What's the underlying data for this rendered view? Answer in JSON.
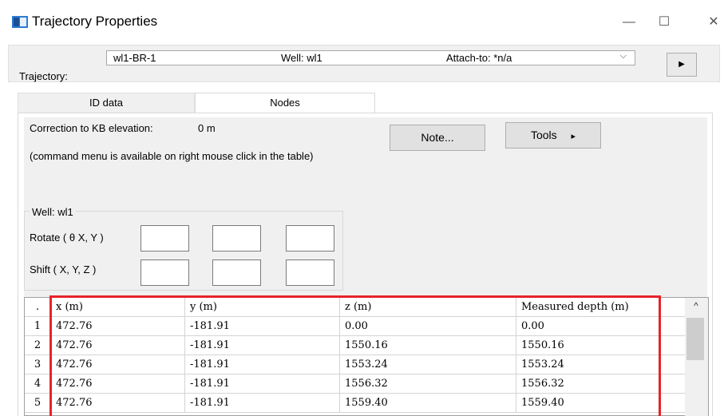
{
  "window": {
    "title": "Trajectory Properties",
    "minimize": "—",
    "maximize": "☐",
    "close": "✕"
  },
  "top": {
    "trajectory_label": "Trajectory:",
    "combo": {
      "name": "wl1-BR-1",
      "well": "Well: wl1",
      "attach": "Attach-to: *n/a",
      "arrow": "⌵"
    },
    "play_icon": "▶"
  },
  "tabs": [
    {
      "label": "ID data",
      "active": false
    },
    {
      "label": "Nodes",
      "active": true
    }
  ],
  "nodes": {
    "correction_label": "Correction to KB elevation:",
    "correction_value": "0  m",
    "hint": "(command menu is available on right mouse click in the table)",
    "note_button": "Note...",
    "tools_button": "Tools",
    "tools_arrow": "▸",
    "group_title": "Well: wl1",
    "rotate_label": "Rotate (  θ  X, Y )",
    "shift_label": "Shift ( X, Y, Z )"
  },
  "table": {
    "headers": [
      ".",
      "x (m)",
      "y (m)",
      "z (m)",
      "Measured depth (m)"
    ],
    "rows": [
      [
        "1",
        "472.76",
        "-181.91",
        "0.00",
        "0.00"
      ],
      [
        "2",
        "472.76",
        "-181.91",
        "1550.16",
        "1550.16"
      ],
      [
        "3",
        "472.76",
        "-181.91",
        "1553.24",
        "1553.24"
      ],
      [
        "4",
        "472.76",
        "-181.91",
        "1556.32",
        "1556.32"
      ],
      [
        "5",
        "472.76",
        "-181.91",
        "1559.40",
        "1559.40"
      ]
    ],
    "scroll_up": "^"
  },
  "colors": {
    "highlight": "#e8232a"
  }
}
